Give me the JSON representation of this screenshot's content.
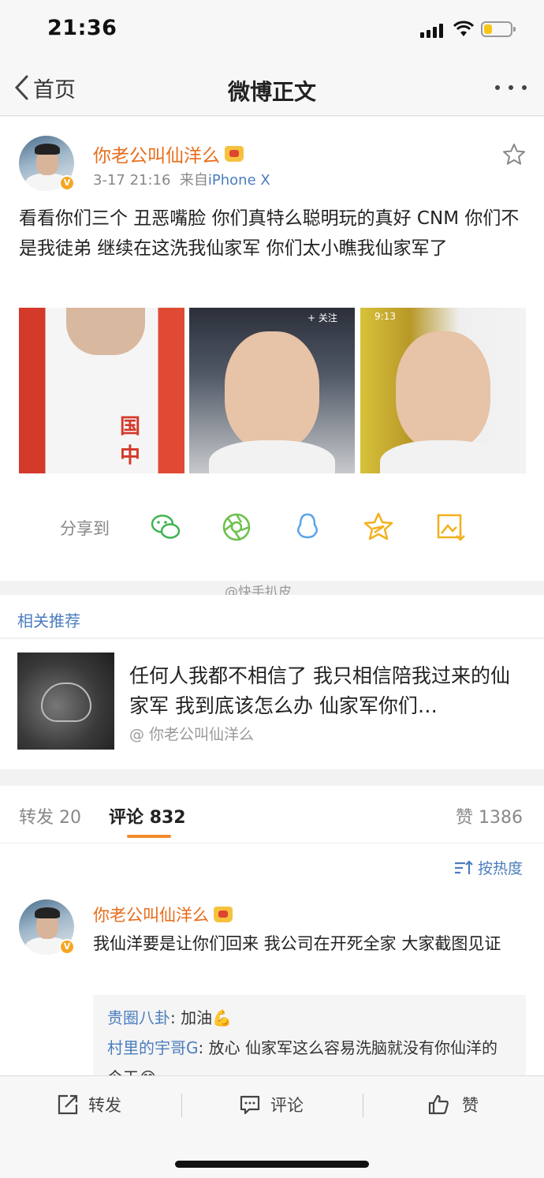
{
  "status_bar": {
    "time": "21:36"
  },
  "nav": {
    "back_label": "首页",
    "title": "微博正文"
  },
  "post": {
    "author": "你老公叫仙洋么",
    "time": "3-17 21:16",
    "source_prefix": "来自",
    "source": "iPhone X",
    "text": "看看你们三个 丑恶嘴脸 你们真特么聪明玩的真好 CNM 你们不是我徒弟  继续在这洗我仙家军 你们太小瞧我仙家军了",
    "share_label": "分享到",
    "share_targets": [
      "wechat-icon",
      "moments-icon",
      "qq-icon",
      "qzone-icon",
      "save-image-icon"
    ],
    "image2_toolbar": "+ 关注",
    "image3_time": "9:13"
  },
  "watermark": "@快手扒皮",
  "related": {
    "header": "相关推荐",
    "item": {
      "title": "任何人我都不相信了 我只相信陪我过来的仙家军 我到底该怎么办 仙家军你们…",
      "source": "@ 你老公叫仙洋么"
    }
  },
  "tabs": {
    "repost_label": "转发",
    "repost_count": "20",
    "comment_label": "评论",
    "comment_count": "832",
    "like_label": "赞",
    "like_count": "1386"
  },
  "sort_label": "按热度",
  "comment": {
    "author": "你老公叫仙洋么",
    "text": "我仙洋要是让你们回来 我公司在开死全家 大家截图见证",
    "replies": [
      {
        "user": "贵圈八卦",
        "text": "加油💪"
      },
      {
        "user": "村里的宇哥G",
        "text": "放心 仙家军这么容易洗脑就没有你仙洋的今天😂"
      }
    ]
  },
  "toolbar": {
    "repost": "转发",
    "comment": "评论",
    "like": "赞"
  },
  "colors": {
    "accent_orange": "#e86c1a",
    "link_blue": "#4b7dbf",
    "tab_underline": "#f08b2a"
  }
}
